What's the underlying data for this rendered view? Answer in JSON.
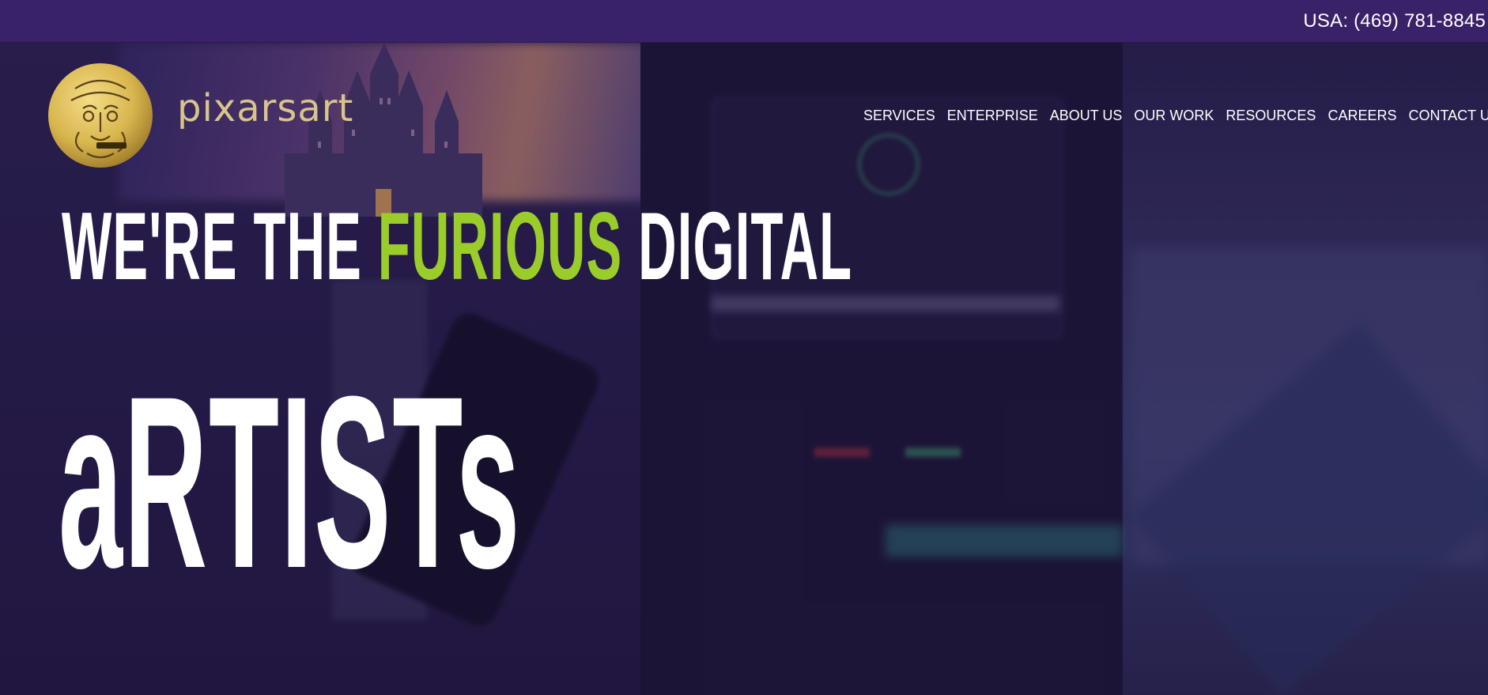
{
  "topbar": {
    "phone": "USA: (469) 781-8845"
  },
  "header": {
    "brand_name": "pixarsart",
    "logo_icon": "lion-face-icon"
  },
  "nav": {
    "items": [
      {
        "label": "SERVICES"
      },
      {
        "label": "ENTERPRISE"
      },
      {
        "label": "ABOUT US"
      },
      {
        "label": "OUR WORK"
      },
      {
        "label": "RESOURCES"
      },
      {
        "label": "CAREERS"
      },
      {
        "label": "CONTACT US"
      }
    ]
  },
  "hero": {
    "headline_part1": "WE'RE THE ",
    "headline_accent": "FURIOUS",
    "headline_part2": " DIGITAL",
    "headline_big": "aRTISTs"
  },
  "colors": {
    "topbar": "#3a2268",
    "accent": "#9acd2a",
    "brand_text": "#d9c48a",
    "logo_gold": "#d8b64e"
  }
}
